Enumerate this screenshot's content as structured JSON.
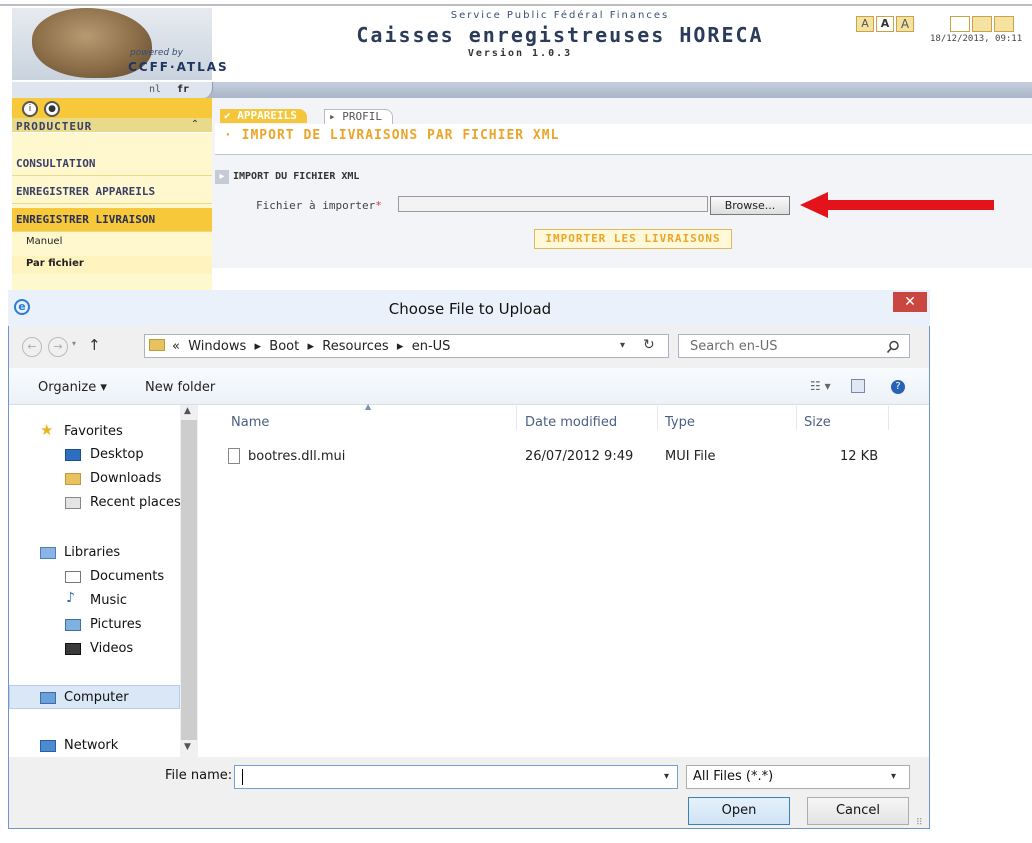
{
  "app": {
    "service": "Service Public Fédéral Finances",
    "title": "Caisses enregistreuses HORECA",
    "version": "Version 1.0.3",
    "powered_by": "powered by",
    "logo_text": "CCFF·ATLAS",
    "datetime": "18/12/2013, 09:11",
    "font_sizes": [
      "A",
      "A",
      "A"
    ],
    "languages": {
      "nl": "nl",
      "fr": "fr"
    }
  },
  "sidebar": {
    "section": "PRODUCTEUR",
    "toggle": "⌃",
    "items": [
      {
        "label": "CONSULTATION"
      },
      {
        "label": "ENREGISTRER APPAREILS"
      },
      {
        "label": "ENREGISTRER LIVRAISON"
      }
    ],
    "subitems": [
      {
        "label": "Manuel"
      },
      {
        "label": "Par fichier"
      }
    ]
  },
  "main": {
    "tabs": [
      {
        "label": "APPAREILS"
      },
      {
        "label": "PROFIL"
      }
    ],
    "page_title": "· IMPORT DE LIVRAISONS PAR FICHIER XML",
    "section_title": "IMPORT DU FICHIER XML",
    "file_label": "Fichier à importer",
    "required_mark": "*",
    "browse_label": "Browse...",
    "import_label": "IMPORTER LES LIVRAISONS"
  },
  "dialog": {
    "title": "Choose File to Upload",
    "close": "✕",
    "address": {
      "crumbs": "«  Windows  ▸  Boot  ▸  Resources  ▸  en-US"
    },
    "search_placeholder": "Search en-US",
    "toolbar": {
      "organize": "Organize ▾",
      "new_folder": "New folder"
    },
    "nav": {
      "favorites": "Favorites",
      "favorites_items": [
        "Desktop",
        "Downloads",
        "Recent places"
      ],
      "libraries": "Libraries",
      "libraries_items": [
        "Documents",
        "Music",
        "Pictures",
        "Videos"
      ],
      "computer": "Computer",
      "network": "Network"
    },
    "columns": [
      "Name",
      "Date modified",
      "Type",
      "Size"
    ],
    "files": [
      {
        "name": "bootres.dll.mui",
        "date": "26/07/2012 9:49",
        "type": "MUI File",
        "size": "12 KB"
      }
    ],
    "file_name_label": "File name:",
    "file_name_value": "",
    "file_type": "All Files (*.*)",
    "open_label": "Open",
    "cancel_label": "Cancel"
  },
  "colors": {
    "accent_orange": "#eba52b",
    "sidebar_yellow": "#f7c93a",
    "arrow_red": "#e4121b",
    "dialog_border": "#6f96c8"
  }
}
